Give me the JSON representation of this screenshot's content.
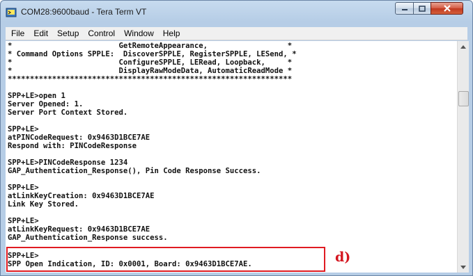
{
  "window": {
    "title": "COM28:9600baud - Tera Term VT",
    "icon": "tera-term-app-icon"
  },
  "menu": [
    {
      "label": "File"
    },
    {
      "label": "Edit"
    },
    {
      "label": "Setup"
    },
    {
      "label": "Control"
    },
    {
      "label": "Window"
    },
    {
      "label": "Help"
    }
  ],
  "terminal": {
    "lines": [
      "*                        GetRemoteAppearance,                  *",
      "* Command Options SPPLE:  DiscoverSPPLE, RegisterSPPLE, LESend, *",
      "*                        ConfigureSPPLE, LERead, Loopback,     *",
      "*                        DisplayRawModeData, AutomaticReadMode *",
      "****************************************************************",
      "",
      "SPP+LE>open 1",
      "Server Opened: 1.",
      "Server Port Context Stored.",
      "",
      "SPP+LE>",
      "atPINCodeRequest: 0x9463D1BCE7AE",
      "Respond with: PINCodeResponse",
      "",
      "SPP+LE>PINCodeResponse 1234",
      "GAP_Authentication_Response(), Pin Code Response Success.",
      "",
      "SPP+LE>",
      "atLinkKeyCreation: 0x9463D1BCE7AE",
      "Link Key Stored.",
      "",
      "SPP+LE>",
      "atLinkKeyRequest: 0x9463D1BCE7AE",
      "GAP_Authentication_Response success.",
      "",
      "SPP+LE>",
      "SPP Open Indication, ID: 0x0001, Board: 0x9463D1BCE7AE."
    ]
  },
  "annotation": {
    "label": "d)",
    "color": "#e01b22"
  },
  "colors": {
    "titlebar": "#b6cde6",
    "close_button": "#c0381f",
    "terminal_bg": "#ffffff",
    "terminal_text": "#111111"
  }
}
